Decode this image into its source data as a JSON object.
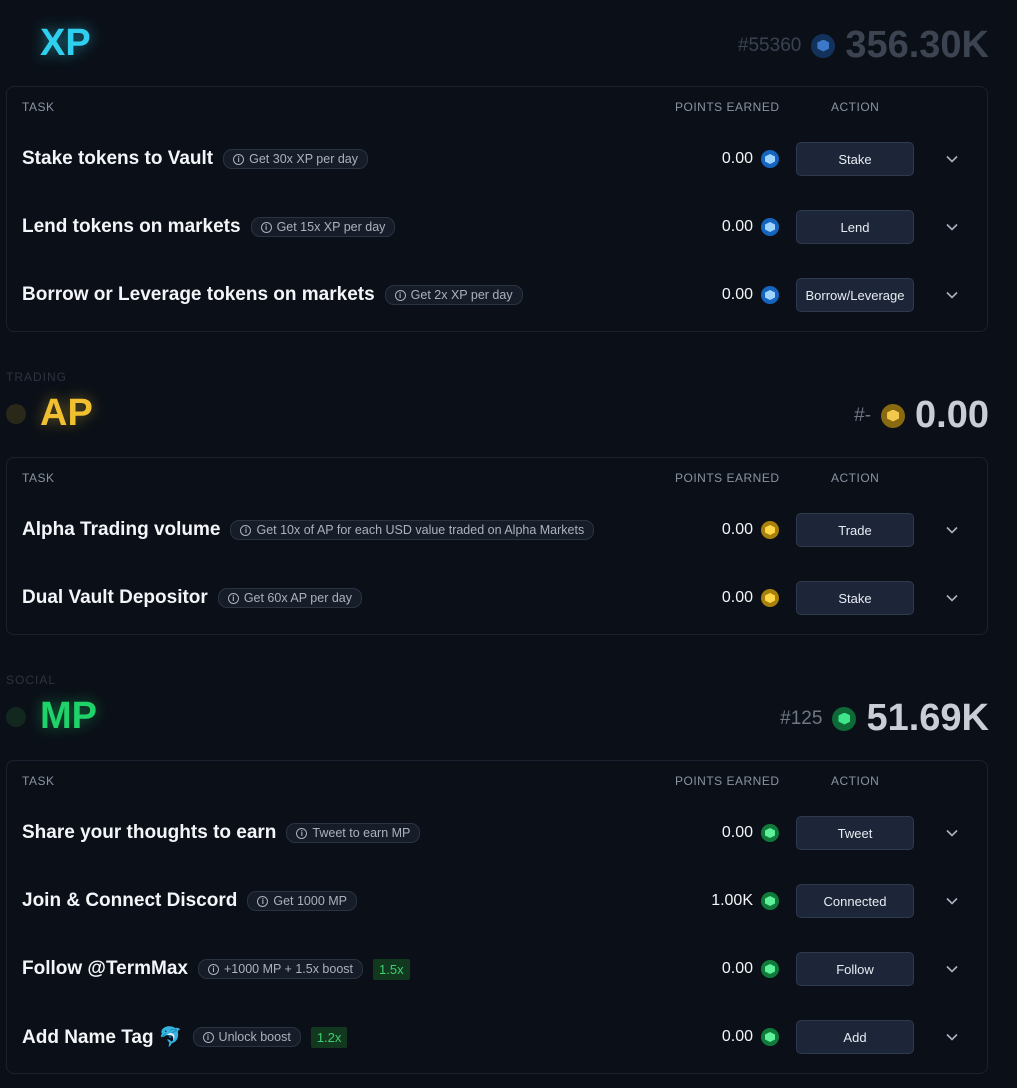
{
  "colors": {
    "xp": "#2fd0ef",
    "ap": "#f0c030",
    "mp": "#1fd36a"
  },
  "columns": {
    "task": "TASK",
    "points": "POINTS EARNED",
    "action": "ACTION"
  },
  "sections": [
    {
      "category": "",
      "title": "XP",
      "rank": "#55360",
      "total": "356.30K",
      "token_icon": "xp-token-icon",
      "tasks": [
        {
          "title": "Stake tokens to Vault",
          "info": "Get 30x XP per day",
          "boost": "",
          "points": "0.00",
          "action": "Stake"
        },
        {
          "title": "Lend tokens on markets",
          "info": "Get 15x XP per day",
          "boost": "",
          "points": "0.00",
          "action": "Lend"
        },
        {
          "title": "Borrow or Leverage tokens on markets",
          "info": "Get 2x XP per day",
          "boost": "",
          "points": "0.00",
          "action": "Borrow/Leverage"
        }
      ]
    },
    {
      "category": "TRADING",
      "title": "AP",
      "rank": "#-",
      "total": "0.00",
      "token_icon": "ap-token-icon",
      "tasks": [
        {
          "title": "Alpha Trading volume",
          "info": "Get 10x of AP for each USD value traded on Alpha Markets",
          "boost": "",
          "points": "0.00",
          "action": "Trade"
        },
        {
          "title": "Dual Vault Depositor",
          "info": "Get 60x AP per day",
          "boost": "",
          "points": "0.00",
          "action": "Stake"
        }
      ]
    },
    {
      "category": "SOCIAL",
      "title": "MP",
      "rank": "#125",
      "total": "51.69K",
      "token_icon": "mp-token-icon",
      "tasks": [
        {
          "title": "Share your thoughts to earn",
          "info": "Tweet to earn MP",
          "boost": "",
          "points": "0.00",
          "action": "Tweet"
        },
        {
          "title": "Join & Connect Discord",
          "info": "Get 1000 MP",
          "boost": "",
          "points": "1.00K",
          "action": "Connected"
        },
        {
          "title": "Follow @TermMax",
          "info": "+1000 MP + 1.5x boost",
          "boost": "1.5x",
          "points": "0.00",
          "action": "Follow"
        },
        {
          "title": "Add Name Tag 🐬",
          "info": "Unlock boost",
          "boost": "1.2x",
          "points": "0.00",
          "action": "Add"
        }
      ]
    }
  ]
}
